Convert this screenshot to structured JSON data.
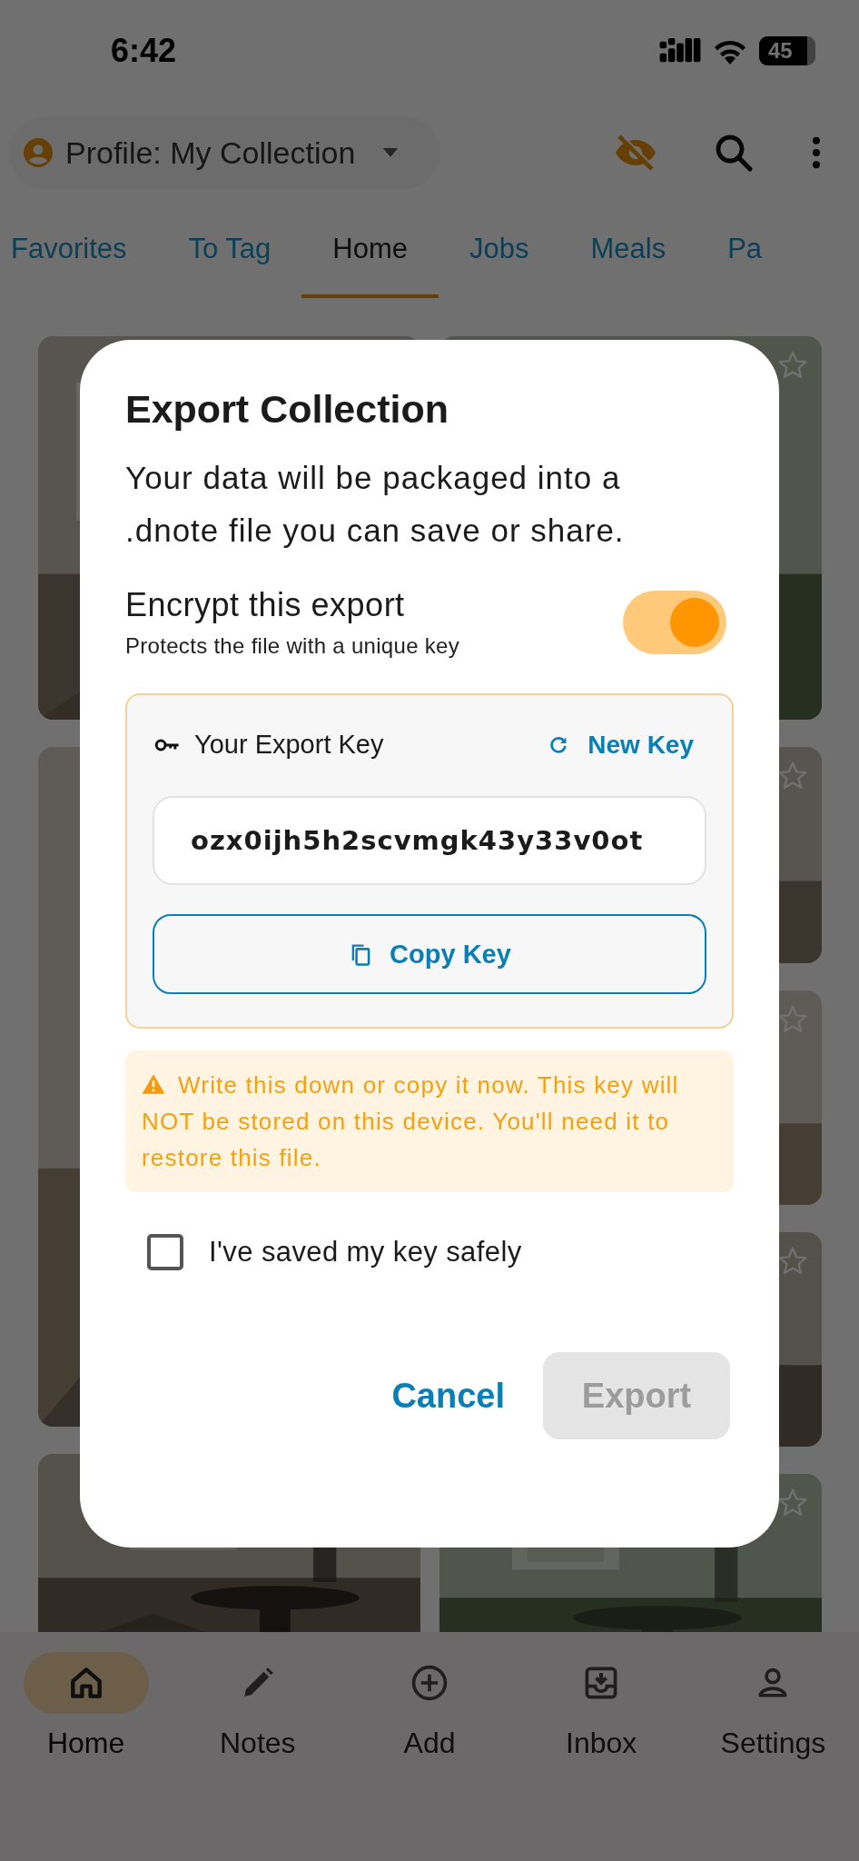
{
  "status_bar": {
    "time": "6:42",
    "battery": "45"
  },
  "profile": {
    "label": "Profile: My Collection"
  },
  "tabs": [
    {
      "label": "Favorites",
      "selected": false
    },
    {
      "label": "To Tag",
      "selected": false
    },
    {
      "label": "Home",
      "selected": true
    },
    {
      "label": "Jobs",
      "selected": false
    },
    {
      "label": "Meals",
      "selected": false
    },
    {
      "label": "Pa",
      "selected": false
    }
  ],
  "dialog": {
    "title": "Export Collection",
    "description": "Your data will be packaged into a .dnote file you can save or share.",
    "encrypt": {
      "label": "Encrypt this export",
      "hint": "Protects the file with a unique key",
      "on": true
    },
    "key_panel": {
      "label": "Your Export Key",
      "new_key": "New Key",
      "key_value": "ozx0ijh5h2scvmgk43y33v0ot",
      "copy_button": "Copy Key"
    },
    "warning": "Write this down or copy it now. This key will NOT be stored on this device. You'll need it to restore this file.",
    "confirm": {
      "label": "I've saved my key safely",
      "checked": false
    },
    "buttons": [
      {
        "label": "Cancel",
        "kind": "text",
        "disabled": false
      },
      {
        "label": "Export",
        "kind": "filled",
        "disabled": true
      }
    ]
  },
  "nav": [
    {
      "label": "Home",
      "selected": true
    },
    {
      "label": "Notes",
      "selected": false
    },
    {
      "label": "Add",
      "selected": false
    },
    {
      "label": "Inbox",
      "selected": false
    },
    {
      "label": "Settings",
      "selected": false
    }
  ]
}
